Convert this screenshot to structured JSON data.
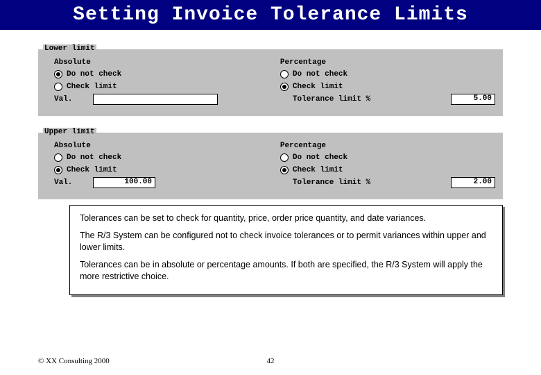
{
  "title": "Setting Invoice Tolerance Limits",
  "panels": {
    "lower": {
      "legend": "Lower limit",
      "absolute": {
        "heading": "Absolute",
        "opt_dnc": "Do not check",
        "opt_chk": "Check limit",
        "val_label": "Val.",
        "val_value": ""
      },
      "percentage": {
        "heading": "Percentage",
        "opt_dnc": "Do not check",
        "opt_chk": "Check limit",
        "tol_label": "Tolerance limit %",
        "tol_value": "5.00"
      }
    },
    "upper": {
      "legend": "Upper limit",
      "absolute": {
        "heading": "Absolute",
        "opt_dnc": "Do not check",
        "opt_chk": "Check limit",
        "val_label": "Val.",
        "val_value": "100.00"
      },
      "percentage": {
        "heading": "Percentage",
        "opt_dnc": "Do not check",
        "opt_chk": "Check limit",
        "tol_label": "Tolerance limit %",
        "tol_value": "2.00"
      }
    }
  },
  "notes": {
    "p1": "Tolerances can be set to check for quantity, price, order price quantity, and date variances.",
    "p2": "The R/3 System can be configured not to check invoice tolerances or to permit variances within upper and lower limits.",
    "p3": "Tolerances can be in absolute or percentage amounts.  If both are specified, the R/3 System will apply the more restrictive choice."
  },
  "footer": {
    "copyright": "© XX Consulting 2000",
    "page": "42"
  }
}
